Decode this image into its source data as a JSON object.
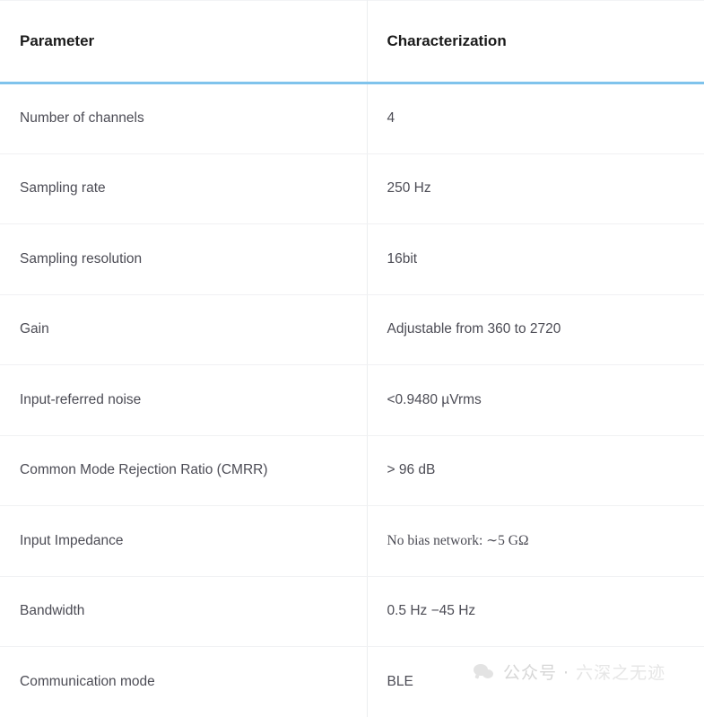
{
  "table": {
    "headers": {
      "parameter": "Parameter",
      "characterization": "Characterization"
    },
    "accent_color": "#7fc3ec",
    "rows": [
      {
        "parameter": "Number of channels",
        "value": "4"
      },
      {
        "parameter": "Sampling rate",
        "value": "250 Hz"
      },
      {
        "parameter": "Sampling resolution",
        "value": "16bit"
      },
      {
        "parameter": "Gain",
        "value": "Adjustable from 360 to 2720"
      },
      {
        "parameter": "Input-referred noise",
        "value": "<0.9480 µVrms"
      },
      {
        "parameter": "Common Mode Rejection Ratio (CMRR)",
        "value": "> 96 dB"
      },
      {
        "parameter": "Input Impedance",
        "value": "No bias network: ∼5 GΩ"
      },
      {
        "parameter": "Bandwidth",
        "value": "0.5 Hz −45 Hz"
      },
      {
        "parameter": "Communication mode",
        "value": "BLE"
      }
    ]
  },
  "watermark": {
    "prefix": "公众号 · ",
    "name": "六深之无迹",
    "logo": "wechat-logo"
  }
}
